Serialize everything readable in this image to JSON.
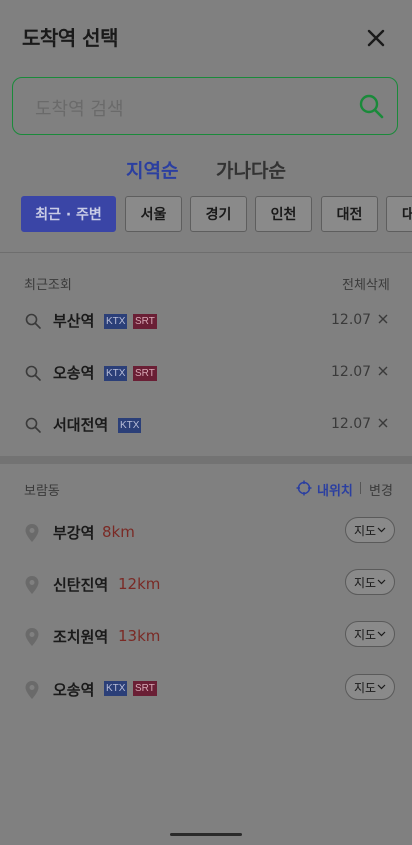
{
  "header": {
    "title": "도착역 선택"
  },
  "search": {
    "placeholder": "도착역 검색"
  },
  "sort_tabs": [
    {
      "label": "지역순",
      "active": true
    },
    {
      "label": "가나다순",
      "active": false
    }
  ],
  "region_chips": [
    {
      "label": "최근 · 주변",
      "active": true
    },
    {
      "label": "서울",
      "active": false
    },
    {
      "label": "경기",
      "active": false
    },
    {
      "label": "인천",
      "active": false
    },
    {
      "label": "대전",
      "active": false
    },
    {
      "label": "대",
      "active": false
    }
  ],
  "recent": {
    "label": "최근조회",
    "clear_all": "전체삭제",
    "items": [
      {
        "name": "부산역",
        "ktx": "KTX",
        "srt": "SRT",
        "date": "12.07"
      },
      {
        "name": "오송역",
        "ktx": "KTX",
        "srt": "SRT",
        "date": "12.07"
      },
      {
        "name": "서대전역",
        "ktx": "KTX",
        "srt": null,
        "date": "12.07"
      }
    ]
  },
  "nearby": {
    "area": "보람동",
    "my_location": "내위치",
    "change": "변경",
    "map_label": "지도",
    "items": [
      {
        "name": "부강역",
        "distance": "8km",
        "ktx": null,
        "srt": null
      },
      {
        "name": "신탄진역",
        "distance": "12km",
        "ktx": null,
        "srt": null
      },
      {
        "name": "조치원역",
        "distance": "13km",
        "ktx": null,
        "srt": null
      },
      {
        "name": "오송역",
        "distance": null,
        "ktx": "KTX",
        "srt": "SRT"
      }
    ]
  },
  "colors": {
    "overlay": "#808080",
    "accent_blue": "#2b3fa0",
    "search_border": "#1a8a3a",
    "distance_red": "#7a2a25"
  }
}
